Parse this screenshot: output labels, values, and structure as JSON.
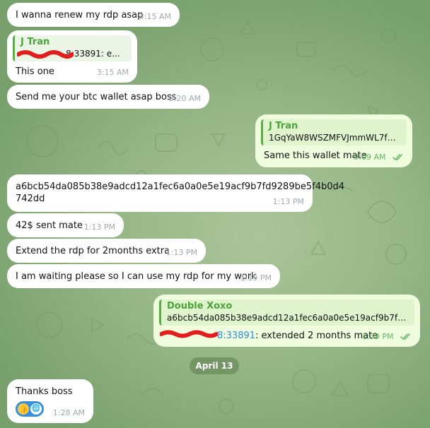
{
  "messages": [
    {
      "text": "I wanna renew my rdp asap",
      "time": "3:15 AM"
    },
    {
      "reply_name": "J Tran",
      "reply_text": "8:33891: e...",
      "text": "This one",
      "time": "3:15 AM"
    },
    {
      "text": "Send me your btc wallet asap boss",
      "time": "3:20 AM"
    },
    {
      "reply_name": "J Tran",
      "reply_text": "1GqYaW8WSZMFVJmmWL7fd2...",
      "text": "Same this wallet mate",
      "time": "9:09 AM"
    },
    {
      "text_line1": "a6bcb54da085b38e9adcd12a1fec6a0a0e5e19acf9b7fd9289be5f4b0d4",
      "text_line2": "742dd",
      "time": "1:13 PM"
    },
    {
      "text": "42$ sent mate",
      "time": "1:13 PM"
    },
    {
      "text": "Extend the rdp for 2months extra",
      "time": "1:13 PM"
    },
    {
      "text": "I am waiting please so I can use my rdp for my work",
      "time": "1:19 PM"
    },
    {
      "reply_name": "Double Xoxo",
      "reply_text": "a6bcb54da085b38e9adcd12a1fec6a0a0e5e19acf9b7fd9...",
      "link_text": "8:33891",
      "text": ": extended 2 months mate",
      "time": "1:39 PM"
    },
    {
      "text": "Thanks boss",
      "time": "1:28 AM",
      "reactions": [
        "👍",
        "🌐"
      ]
    }
  ],
  "date_separator": "April 13",
  "colors": {
    "incoming_bubble": "#ffffff",
    "outgoing_bubble": "#effdde",
    "accent_green": "#4ca33c",
    "redaction": "#e11d1d",
    "link": "#2f8ed9"
  },
  "icons": {
    "read_receipt": "double-check-icon",
    "reaction_badge": "reaction-badge"
  }
}
